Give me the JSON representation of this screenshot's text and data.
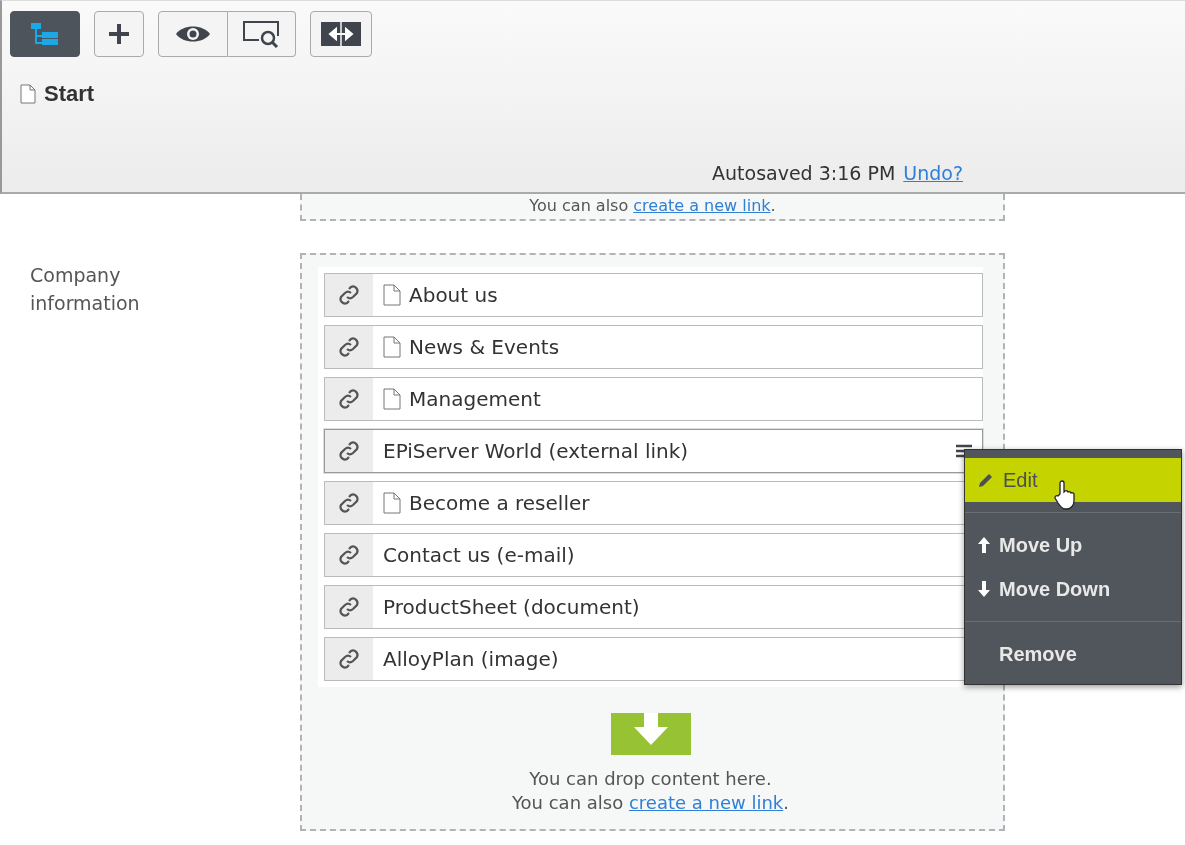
{
  "toolbar": [
    {
      "kind": "tree",
      "selected": true
    },
    {
      "kind": "add",
      "selected": false
    },
    {
      "kind": "view",
      "selected": false
    },
    {
      "kind": "preview",
      "selected": false
    },
    {
      "kind": "compare",
      "selected": false
    }
  ],
  "page_title": "Start",
  "autosave": {
    "text": "Autosaved 3:16 PM",
    "link": "Undo?"
  },
  "previous_dropzone": {
    "prefix": "You can also ",
    "link": "create a new link",
    "suffix": "."
  },
  "field_label": "Company information",
  "links": [
    {
      "kind": "page",
      "label": "About us",
      "selected": false
    },
    {
      "kind": "page",
      "label": "News & Events",
      "selected": false
    },
    {
      "kind": "page",
      "label": "Management",
      "selected": false
    },
    {
      "kind": "external",
      "label": "EPiServer World (external link)",
      "selected": true
    },
    {
      "kind": "page",
      "label": "Become a reseller",
      "selected": false
    },
    {
      "kind": "external",
      "label": "Contact us (e-mail)",
      "selected": false
    },
    {
      "kind": "external",
      "label": "ProductSheet (document)",
      "selected": false
    },
    {
      "kind": "external",
      "label": "AlloyPlan (image)",
      "selected": false
    }
  ],
  "context_menu": [
    {
      "kind": "edit",
      "label": "Edit",
      "selected": true
    },
    {
      "kind": "divider"
    },
    {
      "kind": "up",
      "label": "Move Up",
      "selected": false
    },
    {
      "kind": "down",
      "label": "Move Down",
      "selected": false
    },
    {
      "kind": "divider"
    },
    {
      "kind": "none",
      "label": "Remove",
      "selected": false
    }
  ],
  "dropzone": {
    "line1": "You can drop content here.",
    "prefix": "You can also ",
    "link": "create a new link",
    "suffix": "."
  }
}
